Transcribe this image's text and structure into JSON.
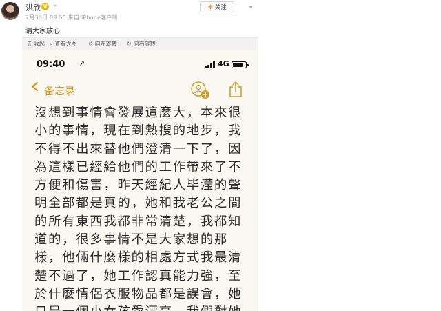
{
  "post": {
    "username": "洪欣",
    "meta": "7月30日 09:55 来自 iPhone客户端",
    "follow_label": "关注",
    "text": "请大家放心"
  },
  "image_toolbar": {
    "items": [
      {
        "label": "收起",
        "icon": "collapse-icon"
      },
      {
        "label": "查看大图",
        "icon": "zoom-icon"
      },
      {
        "label": "向左旋转",
        "icon": "rotate-left-icon"
      },
      {
        "label": "向右旋转",
        "icon": "rotate-right-icon"
      }
    ]
  },
  "phone": {
    "status": {
      "time": "09:40",
      "network": "4G"
    },
    "nav": {
      "back_label": "备忘录"
    },
    "note_lines": [
      "沒想到事情會發展這麼大，本來很",
      "小的事情，現在到熱搜的地步，我",
      "不得不出來替他們澄清一下了，因",
      "為這樣已經給他們的工作帶來了不",
      "方便和傷害，昨天經紀人毕滢的聲",
      "明全部都是真的，她和我老公之間",
      "的所有東西我都非常清楚，我都知",
      "道的，很多事情不是大家想的那",
      "樣，他倆什麼樣的相處方式我最清",
      "楚不過了，她工作認真能力強，至",
      "於什麼情侶衣服物品都是誤會，她",
      "只是一個小女孩愛漂亮，我們對她"
    ]
  },
  "colors": {
    "accent": "#d59a1e",
    "note_bg": "#f9f8f3",
    "vip": "#f5b800"
  }
}
